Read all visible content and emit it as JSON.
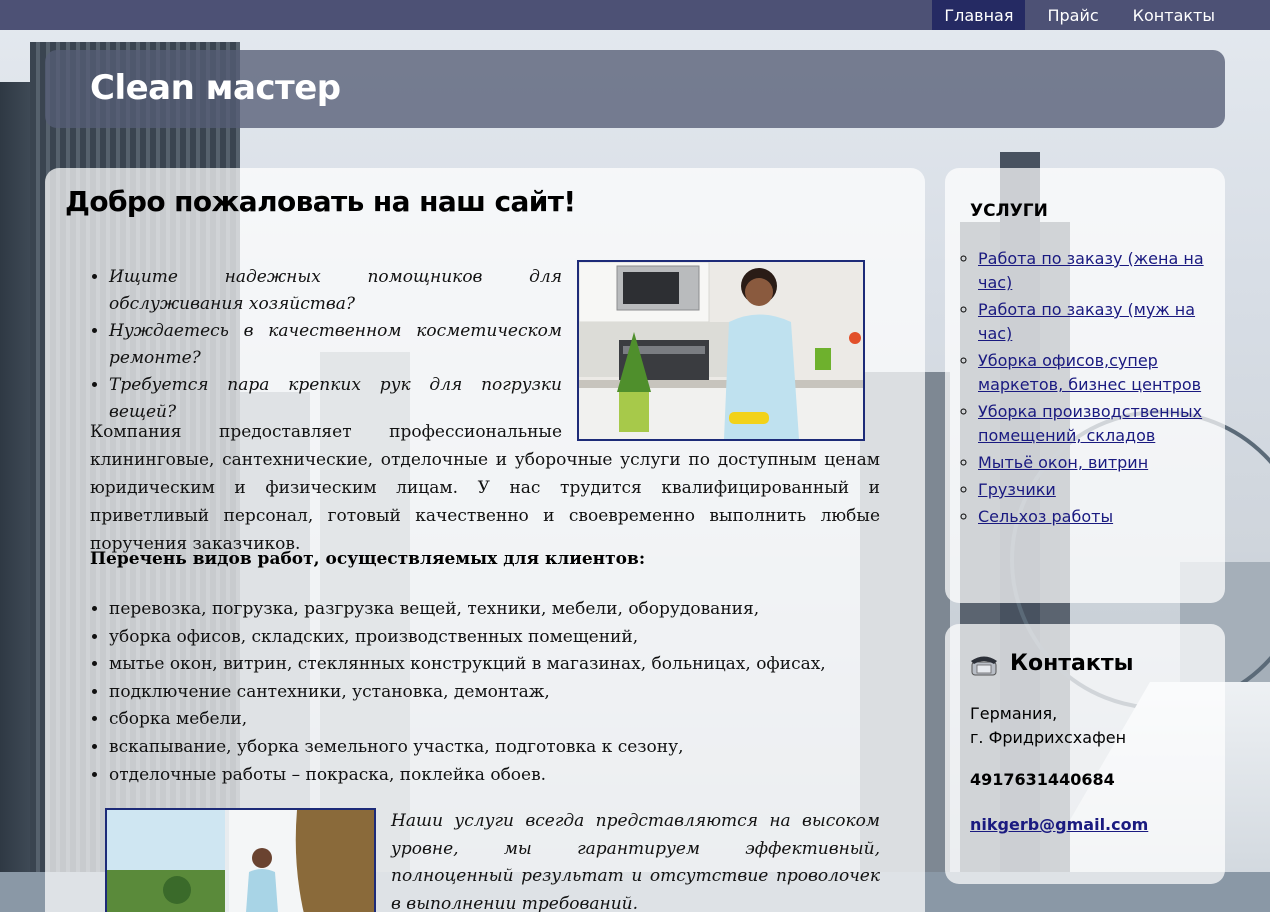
{
  "nav": {
    "items": [
      {
        "label": "Главная",
        "active": true
      },
      {
        "label": "Прайс",
        "active": false
      },
      {
        "label": "Контакты",
        "active": false
      }
    ]
  },
  "header": {
    "site_title": "Clean мастер"
  },
  "main": {
    "page_title": "Добро пожаловать на наш сайт!",
    "questions": [
      "Ищите надежных помощников для обслуживания хозяйства?",
      "Нуждаетесь в качественном косметическом ремонте?",
      "Требуется пара крепких рук для погрузки вещей?"
    ],
    "intro": "Компания предоставляет профессиональные клининговые, сантехнические, отделочные и уборочные услуги по доступным ценам юридическим и физическим лицам. У нас трудится квалифицированный и приветливый персонал, готовый качественно и своевременно выполнить любые поручения заказчиков.",
    "services_heading": "Перечень видов работ, осуществляемых для клиентов:",
    "works": [
      "перевозка, погрузка, разгрузка вещей, техники, мебели, оборудования,",
      "уборка офисов, складских, производственных помещений,",
      "мытье окон, витрин, стеклянных конструкций в магазинах, больницах, офисах,",
      "подключение сантехники, установка, демонтаж,",
      "сборка мебели,",
      "вскапывание, уборка земельного участка, подготовка к сезону,",
      "отделочные работы – покраска, поклейка обоев."
    ],
    "closing": "Наши услуги всегда представляются на высоком уровне, мы гарантируем эффективный, полноценный результат и отсутствие проволочек в выполнении требований."
  },
  "sidebar": {
    "services_title": "УСЛУГИ",
    "services": [
      "Работа по заказу (жена на час)",
      "Работа по заказу (муж на час)",
      "Уборка офисов,супер маркетов, бизнес центров",
      "Уборка производственных помещений, складов",
      "Мытьё окон, витрин",
      "Грузчики",
      "Сельхоз работы"
    ],
    "contacts_title": "Контакты",
    "country": "Германия,",
    "city": "г. Фридрихсхафен",
    "phone": "4917631440684",
    "email": "nikgerb@gmail.com"
  },
  "colors": {
    "nav_bg": "#2c305a",
    "nav_active": "#252a63",
    "link": "#1a1a80",
    "image_border": "#1d2b78"
  }
}
